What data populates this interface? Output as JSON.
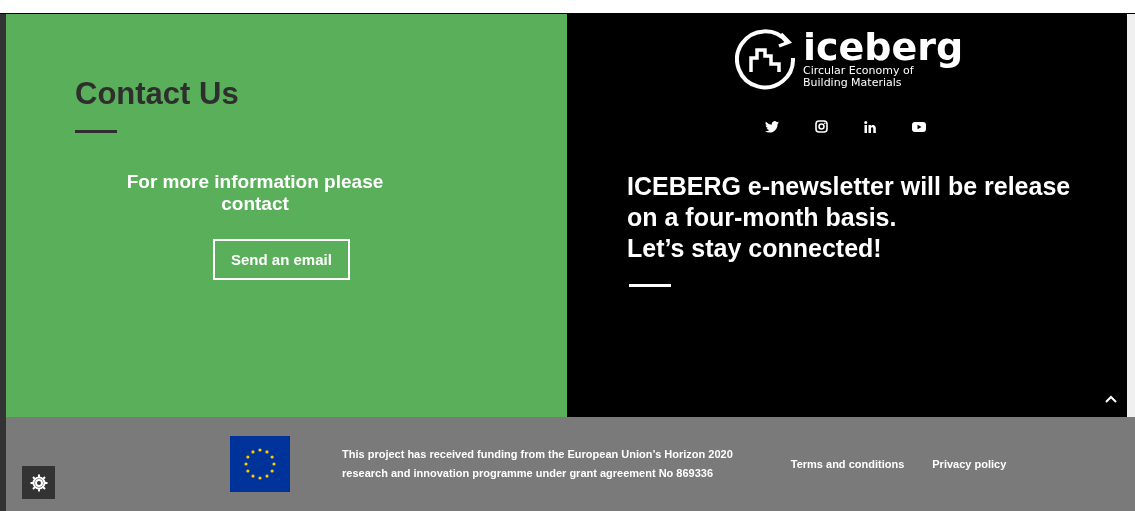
{
  "contact": {
    "title": "Contact Us",
    "text": "For more information please contact",
    "button": "Send an email"
  },
  "logo": {
    "name": "iceberg",
    "tagline_1": "Circular Economy of",
    "tagline_2": "Building Materials"
  },
  "social": [
    {
      "kind": "twitter"
    },
    {
      "kind": "instagram"
    },
    {
      "kind": "linkedin"
    },
    {
      "kind": "youtube"
    }
  ],
  "newsletter": {
    "lines": [
      "ICEBERG e-newsletter will be release",
      "on a four-month basis.",
      "Let’s stay connected!"
    ]
  },
  "footer": {
    "funding": [
      "This project has received funding from the European Union’s Horizon 2020",
      "research and innovation programme under grant agreement No 869336"
    ],
    "links": [
      "Terms and conditions",
      "Privacy policy"
    ]
  }
}
